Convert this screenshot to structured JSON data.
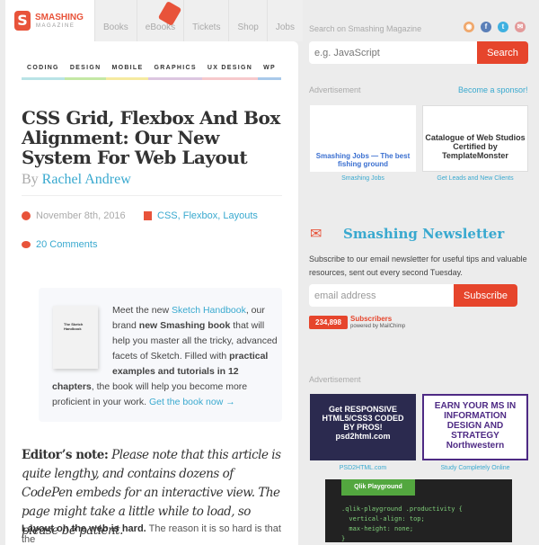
{
  "header": {
    "logo_name": "SMASHING",
    "logo_sub": "MAGAZINE",
    "tabs": [
      "Books",
      "eBooks",
      "Tickets",
      "Shop",
      "Jobs"
    ]
  },
  "categories": [
    {
      "label": "CODING",
      "color": "#b9e3e6"
    },
    {
      "label": "DESIGN",
      "color": "#c4e8a5"
    },
    {
      "label": "MOBILE",
      "color": "#f5eaa0"
    },
    {
      "label": "GRAPHICS",
      "color": "#dcc6e0"
    },
    {
      "label": "UX DESIGN",
      "color": "#f6c9cc"
    },
    {
      "label": "WP",
      "color": "#a9c9ea"
    }
  ],
  "article": {
    "title": "CSS Grid, Flexbox And Box Alignment: Our New System For Web Layout",
    "by": "By",
    "author": "Rachel Andrew",
    "date": "November 8th, 2016",
    "tags": "CSS, Flexbox, Layouts",
    "comments": "20 Comments",
    "promo": {
      "book_title": "The Sketch Handbook",
      "t1": "Meet the new ",
      "link1": "Sketch Handbook",
      "t2": ", our brand ",
      "b1": "new Smashing book",
      "t3": " that will help you master all the tricky, advanced facets of Sketch. Filled with ",
      "b2": "practical examples and tutorials in 12 chapters",
      "t4": ", the book will help you become more proficient in your work. ",
      "link2": "Get the book now →"
    },
    "editor_label": "Editor’s note:",
    "editor_text": " Please note that this article is quite lengthy, and contains dozens of CodePen embeds for an interactive view. The page might take a little while to load, so please be patient.",
    "lead_bold": "Layout on the web is hard.",
    "lead_text": " The reason it is so hard is that the"
  },
  "sidebar": {
    "search_label": "Search on Smashing Magazine",
    "search_placeholder": "e.g. JavaScript",
    "search_button": "Search",
    "social": [
      {
        "icon": "rss-icon",
        "glyph": "◉",
        "color": "#f0a86c"
      },
      {
        "icon": "facebook-icon",
        "glyph": "f",
        "color": "#5a7fb8"
      },
      {
        "icon": "twitter-icon",
        "glyph": "t",
        "color": "#3fb0e0"
      },
      {
        "icon": "email-icon",
        "glyph": "✉",
        "color": "#e39a9a"
      }
    ],
    "ad_label": "Advertisement",
    "sponsor": "Become a sponsor!",
    "ads1": [
      {
        "text": "Smashing Jobs — The best fishing ground",
        "caption": "Smashing Jobs"
      },
      {
        "text": "Catalogue of Web Studios Certified by TemplateMonster",
        "caption": "Get Leads and New Clients"
      }
    ],
    "newsletter": {
      "title": "Smashing Newsletter",
      "desc": "Subscribe to our email newsletter for useful tips and valuable resources, sent out every second Tuesday.",
      "placeholder": "email address",
      "button": "Subscribe",
      "count": "234,898",
      "subscribers": "Subscribers",
      "powered": "powered by MailChimp"
    },
    "ad2_label": "Advertisement",
    "ads2": [
      {
        "text": "Get RESPONSIVE HTML5/CSS3 CODED BY PROS! psd2html.com",
        "caption": "PSD2HTML.com"
      },
      {
        "text": "EARN YOUR MS IN INFORMATION DESIGN AND STRATEGY Northwestern",
        "caption": "Study Completely Online"
      }
    ],
    "code": {
      "badge": "Qlik Playground",
      "lines": [
        ".qlik-playground .productivity {",
        "  vertical-align: top;",
        "  max-height: none;",
        "}"
      ]
    }
  }
}
